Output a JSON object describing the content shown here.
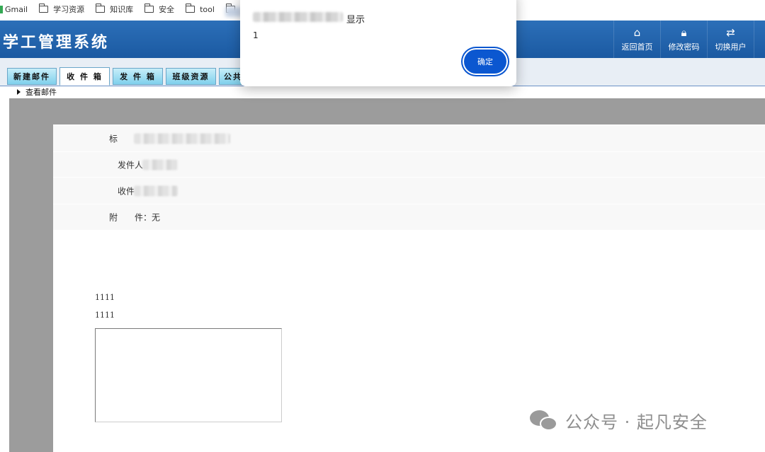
{
  "bookmarks": [
    {
      "label": "Gmail",
      "icon": "gmail-icon"
    },
    {
      "label": "学习资源",
      "icon": "folder-icon"
    },
    {
      "label": "知识库",
      "icon": "folder-icon"
    },
    {
      "label": "安全",
      "icon": "folder-icon"
    },
    {
      "label": "tool",
      "icon": "folder-icon"
    }
  ],
  "header": {
    "title": "学工管理系统",
    "nav": [
      {
        "label": "返回首页",
        "icon": "home-icon"
      },
      {
        "label": "修改密码",
        "icon": "lock-icon"
      },
      {
        "label": "切换用户",
        "icon": "swap-icon"
      }
    ]
  },
  "tabs": [
    {
      "label": "新建邮件"
    },
    {
      "label": "收 件 箱",
      "active": true
    },
    {
      "label": "发 件 箱"
    },
    {
      "label": "班级资源"
    },
    {
      "label": "公共"
    }
  ],
  "breadcrumb": "查看邮件",
  "mail": {
    "subject_label": "标",
    "sender_label": "发件人",
    "recipient_label": "收件",
    "attachment_label": "附　　件：",
    "attachment_value": "无",
    "body_lines": [
      "1111",
      "1111"
    ]
  },
  "alert": {
    "title_suffix": "显示",
    "message": "1",
    "ok_label": "确定"
  },
  "watermark": {
    "text": "公众号 · 起凡安全"
  },
  "colors": {
    "header_bg": "#1f62ad",
    "dialog_button": "#0b57d0",
    "tab_bg": "#9fdcf2",
    "frame_gray": "#9c9c9c"
  }
}
